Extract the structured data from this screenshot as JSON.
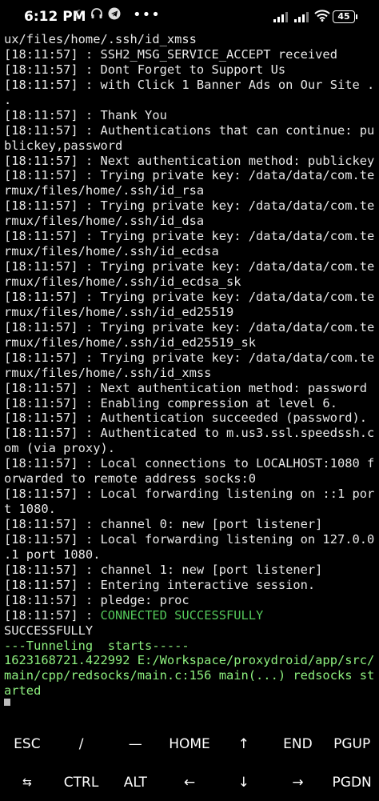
{
  "status_bar": {
    "time": "6:12 PM",
    "icons_left": [
      "moon-icon",
      "headphones-icon",
      "telegram-icon",
      "more-dots-icon"
    ],
    "battery": "45",
    "icons_right": [
      "cell-signal-icon",
      "cell-signal-icon",
      "wifi-icon",
      "battery-icon"
    ]
  },
  "terminal": {
    "lines": [
      {
        "text": "ux/files/home/.ssh/id_xmss",
        "color": "normal"
      },
      {
        "text": "[18:11:57] : SSH2_MSG_SERVICE_ACCEPT received",
        "color": "normal"
      },
      {
        "text": "[18:11:57] : Dont Forget to Support Us",
        "color": "normal"
      },
      {
        "text": "[18:11:57] : with Click 1 Banner Ads on Our Site .",
        "color": "normal"
      },
      {
        "text": ".",
        "color": "normal"
      },
      {
        "text": "[18:11:57] : Thank You",
        "color": "normal"
      },
      {
        "text": "[18:11:57] : Authentications that can continue: pu",
        "color": "normal"
      },
      {
        "text": "blickey,password",
        "color": "normal"
      },
      {
        "text": "[18:11:57] : Next authentication method: publickey",
        "color": "normal"
      },
      {
        "text": "[18:11:57] : Trying private key: /data/data/com.te",
        "color": "normal"
      },
      {
        "text": "rmux/files/home/.ssh/id_rsa",
        "color": "normal"
      },
      {
        "text": "[18:11:57] : Trying private key: /data/data/com.te",
        "color": "normal"
      },
      {
        "text": "rmux/files/home/.ssh/id_dsa",
        "color": "normal"
      },
      {
        "text": "[18:11:57] : Trying private key: /data/data/com.te",
        "color": "normal"
      },
      {
        "text": "rmux/files/home/.ssh/id_ecdsa",
        "color": "normal"
      },
      {
        "text": "[18:11:57] : Trying private key: /data/data/com.te",
        "color": "normal"
      },
      {
        "text": "rmux/files/home/.ssh/id_ecdsa_sk",
        "color": "normal"
      },
      {
        "text": "[18:11:57] : Trying private key: /data/data/com.te",
        "color": "normal"
      },
      {
        "text": "rmux/files/home/.ssh/id_ed25519",
        "color": "normal"
      },
      {
        "text": "[18:11:57] : Trying private key: /data/data/com.te",
        "color": "normal"
      },
      {
        "text": "rmux/files/home/.ssh/id_ed25519_sk",
        "color": "normal"
      },
      {
        "text": "[18:11:57] : Trying private key: /data/data/com.te",
        "color": "normal"
      },
      {
        "text": "rmux/files/home/.ssh/id_xmss",
        "color": "normal"
      },
      {
        "text": "[18:11:57] : Next authentication method: password",
        "color": "normal"
      },
      {
        "text": "[18:11:57] : Enabling compression at level 6.",
        "color": "normal"
      },
      {
        "text": "[18:11:57] : Authentication succeeded (password).",
        "color": "normal"
      },
      {
        "text": "[18:11:57] : Authenticated to m.us3.ssl.speedssh.c",
        "color": "normal"
      },
      {
        "text": "om (via proxy).",
        "color": "normal"
      },
      {
        "text": "[18:11:57] : Local connections to LOCALHOST:1080 f",
        "color": "normal"
      },
      {
        "text": "orwarded to remote address socks:0",
        "color": "normal"
      },
      {
        "text": "[18:11:57] : Local forwarding listening on ::1 por",
        "color": "normal"
      },
      {
        "text": "t 1080.",
        "color": "normal"
      },
      {
        "text": "[18:11:57] : channel 0: new [port listener]",
        "color": "normal"
      },
      {
        "text": "[18:11:57] : Local forwarding listening on 127.0.0",
        "color": "normal"
      },
      {
        "text": ".1 port 1080.",
        "color": "normal"
      },
      {
        "text": "[18:11:57] : channel 1: new [port listener]",
        "color": "normal"
      },
      {
        "text": "[18:11:57] : Entering interactive session.",
        "color": "normal"
      },
      {
        "text": "[18:11:57] : pledge: proc",
        "color": "normal"
      },
      {
        "prefix": "[18:11:57] : ",
        "text": "CONNECTED SUCCESSFULLY",
        "color": "green"
      },
      {
        "text": "SUCCESSFULLY",
        "color": "normal"
      },
      {
        "text": "---Tunneling  starts-----",
        "color": "bright"
      },
      {
        "text": "1623168721.422992 E:/Workspace/proxydroid/app/src/",
        "color": "bright"
      },
      {
        "text": "main/cpp/redsocks/main.c:156 main(...) redsocks st",
        "color": "bright"
      },
      {
        "text": "arted",
        "color": "bright"
      }
    ]
  },
  "extra_keys": {
    "row1": [
      {
        "label": "ESC",
        "name": "esc-key"
      },
      {
        "label": "/",
        "name": "slash-key"
      },
      {
        "label": "—",
        "name": "dash-key"
      },
      {
        "label": "HOME",
        "name": "home-key"
      },
      {
        "label": "↑",
        "name": "arrow-up-key"
      },
      {
        "label": "END",
        "name": "end-key"
      },
      {
        "label": "PGUP",
        "name": "pgup-key"
      }
    ],
    "row2": [
      {
        "label": "⇆",
        "name": "tab-key"
      },
      {
        "label": "CTRL",
        "name": "ctrl-key"
      },
      {
        "label": "ALT",
        "name": "alt-key"
      },
      {
        "label": "←",
        "name": "arrow-left-key"
      },
      {
        "label": "↓",
        "name": "arrow-down-key"
      },
      {
        "label": "→",
        "name": "arrow-right-key"
      },
      {
        "label": "PGDN",
        "name": "pgdn-key"
      }
    ]
  }
}
